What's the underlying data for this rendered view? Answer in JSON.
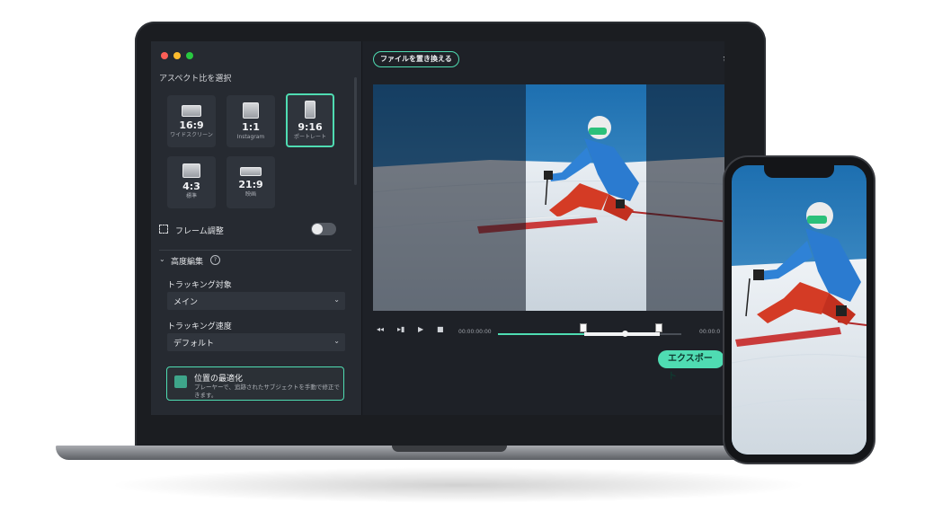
{
  "aspect": {
    "section_title": "アスペクト比を選択",
    "options": [
      {
        "value": "16:9",
        "sub": "ワイドスクリーン"
      },
      {
        "value": "1:1",
        "sub": "Instagram"
      },
      {
        "value": "9:16",
        "sub": "ポートレート",
        "selected": true
      },
      {
        "value": "4:3",
        "sub": "標準"
      },
      {
        "value": "21:9",
        "sub": "映画"
      }
    ]
  },
  "frame_adjust": {
    "label": "フレーム調整",
    "enabled": false
  },
  "advanced": {
    "label": "高度編集",
    "tracking_target_label": "トラッキング対象",
    "tracking_target_value": "メイン",
    "tracking_speed_label": "トラッキング速度",
    "tracking_speed_value": "デフォルト"
  },
  "optimize": {
    "title": "位置の最適化",
    "description": "プレーヤーで、追跡されたサブジェクトを手動で修正できます。"
  },
  "toolbar": {
    "replace_label": "ファイルを置き換える"
  },
  "player": {
    "current_time": "00:00:00:00",
    "end_time": "00:00:0",
    "progress": 0.47
  },
  "export_label": "エクスポート",
  "colors": {
    "accent": "#4fdcb2",
    "panel": "#262a31",
    "background": "#1e2127"
  }
}
